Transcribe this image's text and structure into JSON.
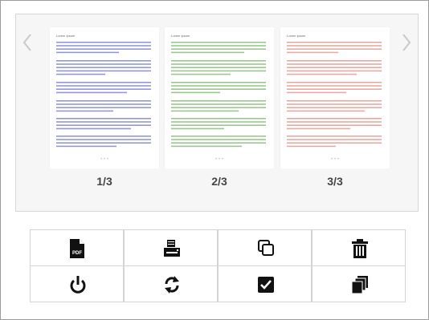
{
  "viewer": {
    "pages": [
      {
        "label": "1/3",
        "title": "Lorem Ipsum",
        "text_color": "#6f74c9",
        "dots": "• • •"
      },
      {
        "label": "2/3",
        "title": "Lorem Ipsum",
        "text_color": "#79b36a",
        "dots": "• • •"
      },
      {
        "label": "3/3",
        "title": "Lorem Ipsum",
        "text_color": "#e08c83",
        "dots": "• • •"
      }
    ],
    "prev_icon": "chevron-left-icon",
    "next_icon": "chevron-right-icon"
  },
  "toolbar": {
    "buttons": [
      {
        "name": "pdf-button",
        "icon": "pdf-icon"
      },
      {
        "name": "print-button",
        "icon": "printer-icon"
      },
      {
        "name": "copy-button",
        "icon": "copy-icon"
      },
      {
        "name": "delete-button",
        "icon": "trash-icon"
      },
      {
        "name": "power-button",
        "icon": "power-icon"
      },
      {
        "name": "refresh-button",
        "icon": "refresh-icon"
      },
      {
        "name": "check-button",
        "icon": "checkbox-checked-icon"
      },
      {
        "name": "duplicate-button",
        "icon": "duplicate-icon"
      }
    ]
  }
}
